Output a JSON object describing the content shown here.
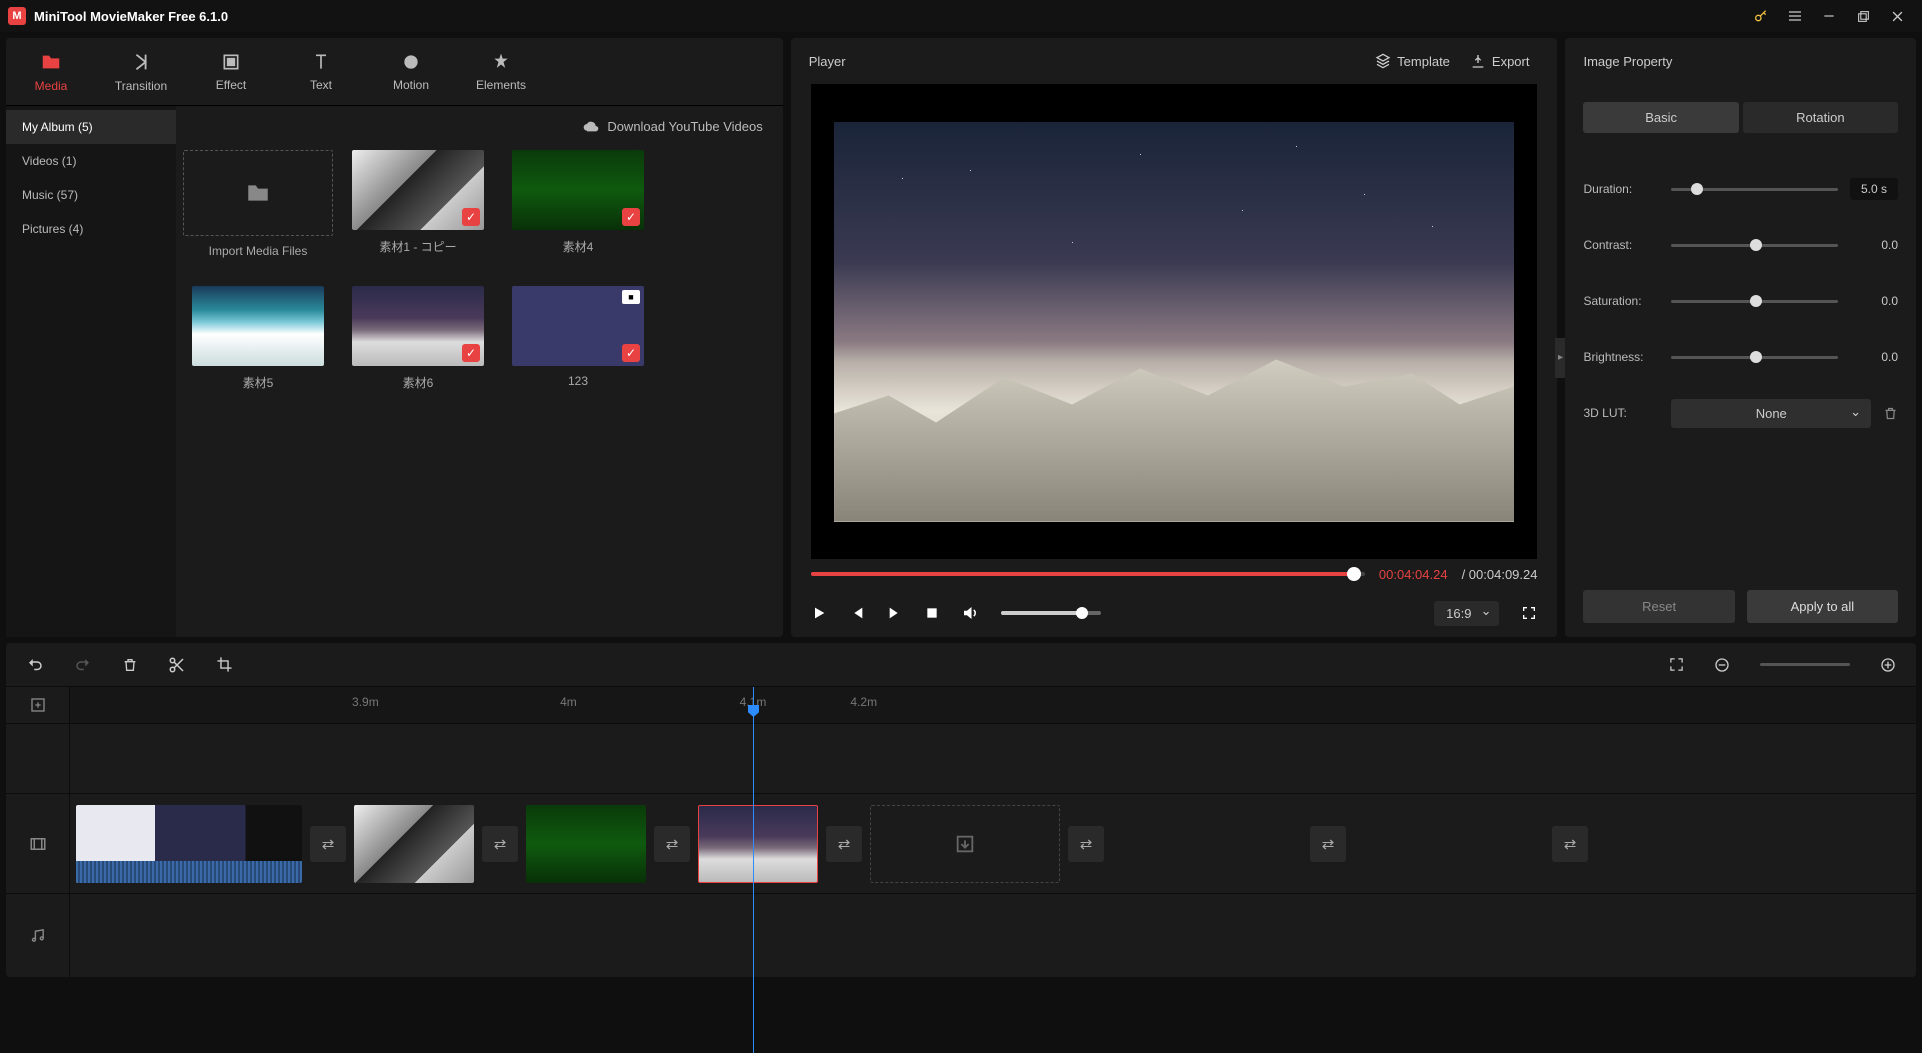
{
  "app": {
    "title": "MiniTool MovieMaker Free 6.1.0"
  },
  "mediaTabs": [
    {
      "label": "Media"
    },
    {
      "label": "Transition"
    },
    {
      "label": "Effect"
    },
    {
      "label": "Text"
    },
    {
      "label": "Motion"
    },
    {
      "label": "Elements"
    }
  ],
  "mediaSidebar": [
    {
      "label": "My Album (5)"
    },
    {
      "label": "Videos (1)"
    },
    {
      "label": "Music (57)"
    },
    {
      "label": "Pictures (4)"
    }
  ],
  "mediaHeader": {
    "download": "Download YouTube Videos"
  },
  "mediaItems": {
    "import": "Import Media Files",
    "i1": "素材1 - コピー",
    "i2": "素材4",
    "i3": "素材5",
    "i4": "素材6",
    "i5": "123"
  },
  "player": {
    "title": "Player",
    "template": "Template",
    "export": "Export",
    "timeCurrent": "00:04:04.24",
    "timeTotal": "/ 00:04:09.24",
    "aspect": "16:9"
  },
  "property": {
    "title": "Image Property",
    "tabBasic": "Basic",
    "tabRotation": "Rotation",
    "duration": {
      "label": "Duration:",
      "value": "5.0 s"
    },
    "contrast": {
      "label": "Contrast:",
      "value": "0.0"
    },
    "saturation": {
      "label": "Saturation:",
      "value": "0.0"
    },
    "brightness": {
      "label": "Brightness:",
      "value": "0.0"
    },
    "lut": {
      "label": "3D LUT:",
      "value": "None"
    },
    "reset": "Reset",
    "apply": "Apply to all"
  },
  "timeline": {
    "ticks": [
      "3.9m",
      "4m",
      "4.1m",
      "4.2m"
    ]
  }
}
